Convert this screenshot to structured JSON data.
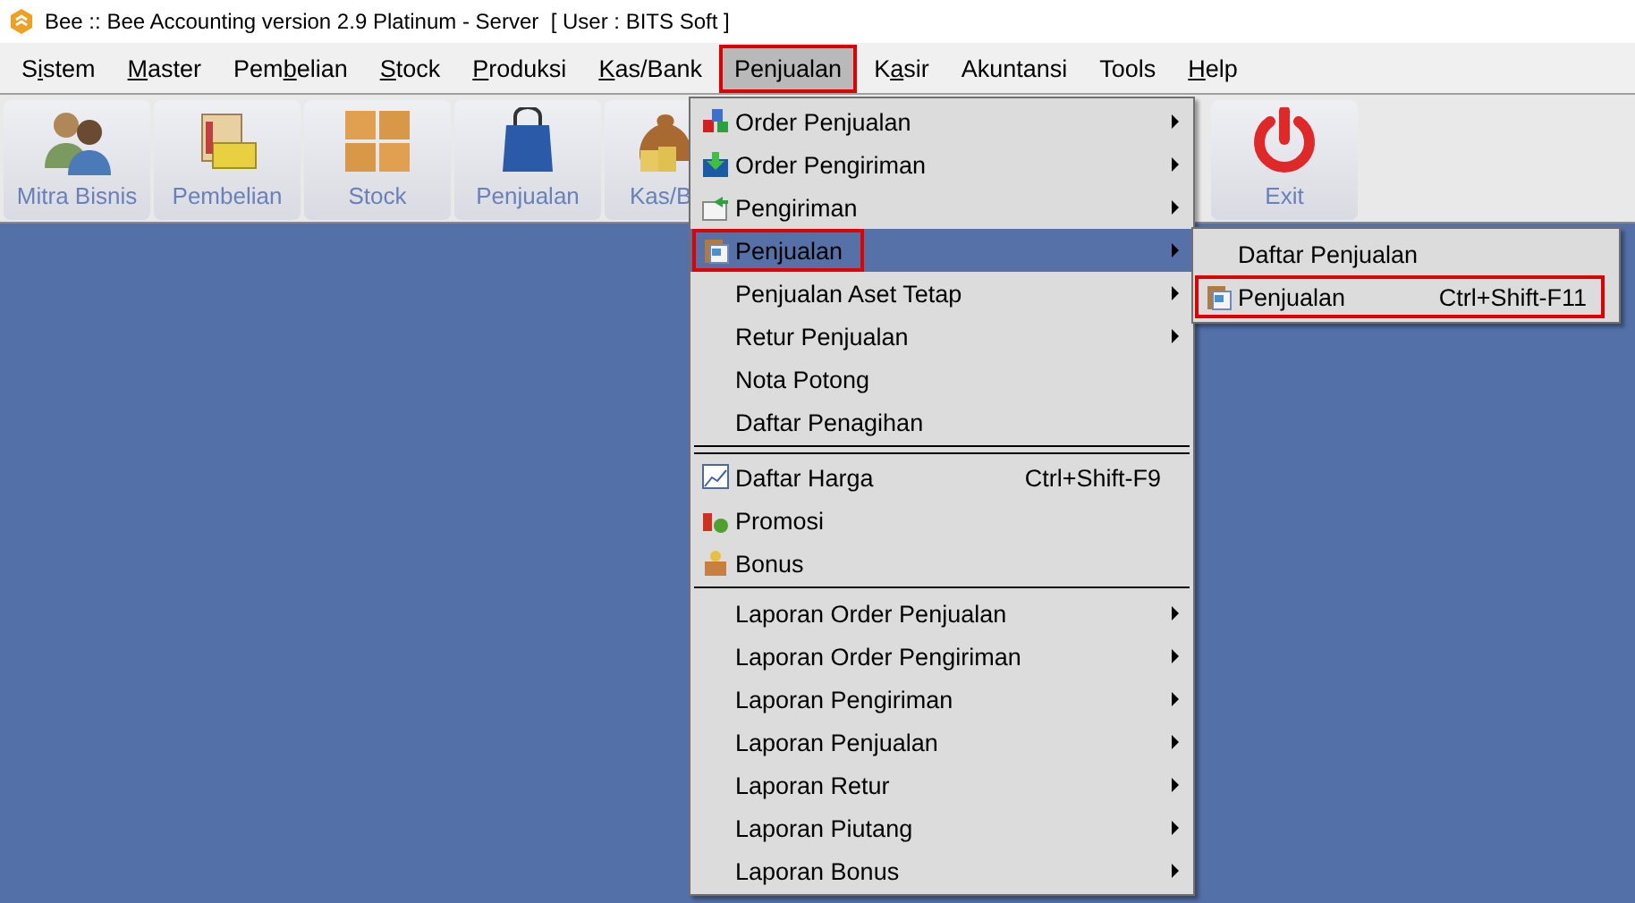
{
  "window": {
    "title": "Bee :: Bee Accounting version 2.9 Platinum - Server  [ User : BITS Soft ]"
  },
  "menubar": [
    {
      "pre": "S",
      "key": "i",
      "post": "stem",
      "open": false,
      "highlighted": false
    },
    {
      "key": "M",
      "post": "aster",
      "open": false,
      "highlighted": false
    },
    {
      "pre": "Pem",
      "key": "b",
      "post": "elian",
      "open": false,
      "highlighted": false
    },
    {
      "key": "S",
      "post": "tock",
      "open": false,
      "highlighted": false
    },
    {
      "key": "P",
      "post": "roduksi",
      "open": false,
      "highlighted": false
    },
    {
      "key": "K",
      "post": "as/Bank",
      "open": false,
      "highlighted": false
    },
    {
      "pre": "Pen",
      "key": "j",
      "post": "ualan",
      "open": true,
      "highlighted": true
    },
    {
      "pre": "K",
      "key": "a",
      "post": "sir",
      "open": false,
      "highlighted": false
    },
    {
      "pre": "Akuntansi",
      "open": false,
      "highlighted": false
    },
    {
      "pre": "Tools",
      "open": false,
      "highlighted": false
    },
    {
      "key": "H",
      "post": "elp",
      "open": false,
      "highlighted": false
    }
  ],
  "toolbar": [
    {
      "label": "Mitra Bisnis"
    },
    {
      "label": "Pembelian"
    },
    {
      "label": "Stock"
    },
    {
      "label": "Penjualan"
    },
    {
      "label": "Kas/B"
    },
    {
      "label": "Exit"
    }
  ],
  "menu": {
    "groups": [
      [
        {
          "label": "Order Penjualan",
          "has_icon": true,
          "has_submenu": true,
          "selected": false,
          "highlighted": false
        },
        {
          "label": "Order Pengiriman",
          "has_icon": true,
          "has_submenu": true,
          "selected": false,
          "highlighted": false
        },
        {
          "label": "Pengiriman",
          "has_icon": true,
          "has_submenu": true,
          "selected": false,
          "highlighted": false
        },
        {
          "label": "Penjualan",
          "has_icon": true,
          "has_submenu": true,
          "selected": true,
          "highlighted": true
        },
        {
          "label": "Penjualan Aset Tetap",
          "has_icon": false,
          "has_submenu": true,
          "selected": false,
          "highlighted": false
        },
        {
          "label": "Retur Penjualan",
          "has_icon": false,
          "has_submenu": true,
          "selected": false,
          "highlighted": false
        },
        {
          "label": "Nota Potong",
          "has_icon": false,
          "has_submenu": false,
          "selected": false,
          "highlighted": false
        },
        {
          "label": "Daftar Penagihan",
          "has_icon": false,
          "has_submenu": false,
          "selected": false,
          "highlighted": false
        }
      ],
      [
        {
          "label": "Daftar Harga",
          "shortcut": "Ctrl+Shift-F9",
          "has_icon": true,
          "has_submenu": false,
          "selected": false,
          "highlighted": false
        },
        {
          "label": "Promosi",
          "has_icon": true,
          "has_submenu": false,
          "selected": false,
          "highlighted": false
        },
        {
          "label": "Bonus",
          "has_icon": true,
          "has_submenu": false,
          "selected": false,
          "highlighted": false
        }
      ],
      [
        {
          "label": "Laporan Order Penjualan",
          "has_icon": false,
          "has_submenu": true,
          "selected": false,
          "highlighted": false
        },
        {
          "label": "Laporan Order Pengiriman",
          "has_icon": false,
          "has_submenu": true,
          "selected": false,
          "highlighted": false
        },
        {
          "label": "Laporan Pengiriman",
          "has_icon": false,
          "has_submenu": true,
          "selected": false,
          "highlighted": false
        },
        {
          "label": "Laporan Penjualan",
          "has_icon": false,
          "has_submenu": true,
          "selected": false,
          "highlighted": false
        },
        {
          "label": "Laporan Retur",
          "has_icon": false,
          "has_submenu": true,
          "selected": false,
          "highlighted": false
        },
        {
          "label": "Laporan Piutang",
          "has_icon": false,
          "has_submenu": true,
          "selected": false,
          "highlighted": false
        },
        {
          "label": "Laporan Bonus",
          "has_icon": false,
          "has_submenu": true,
          "selected": false,
          "highlighted": false
        }
      ]
    ]
  },
  "submenu": [
    {
      "label": "Daftar Penjualan",
      "has_icon": false,
      "highlighted": false
    },
    {
      "label": "Penjualan",
      "shortcut": "Ctrl+Shift-F11",
      "has_icon": true,
      "highlighted": true
    }
  ]
}
